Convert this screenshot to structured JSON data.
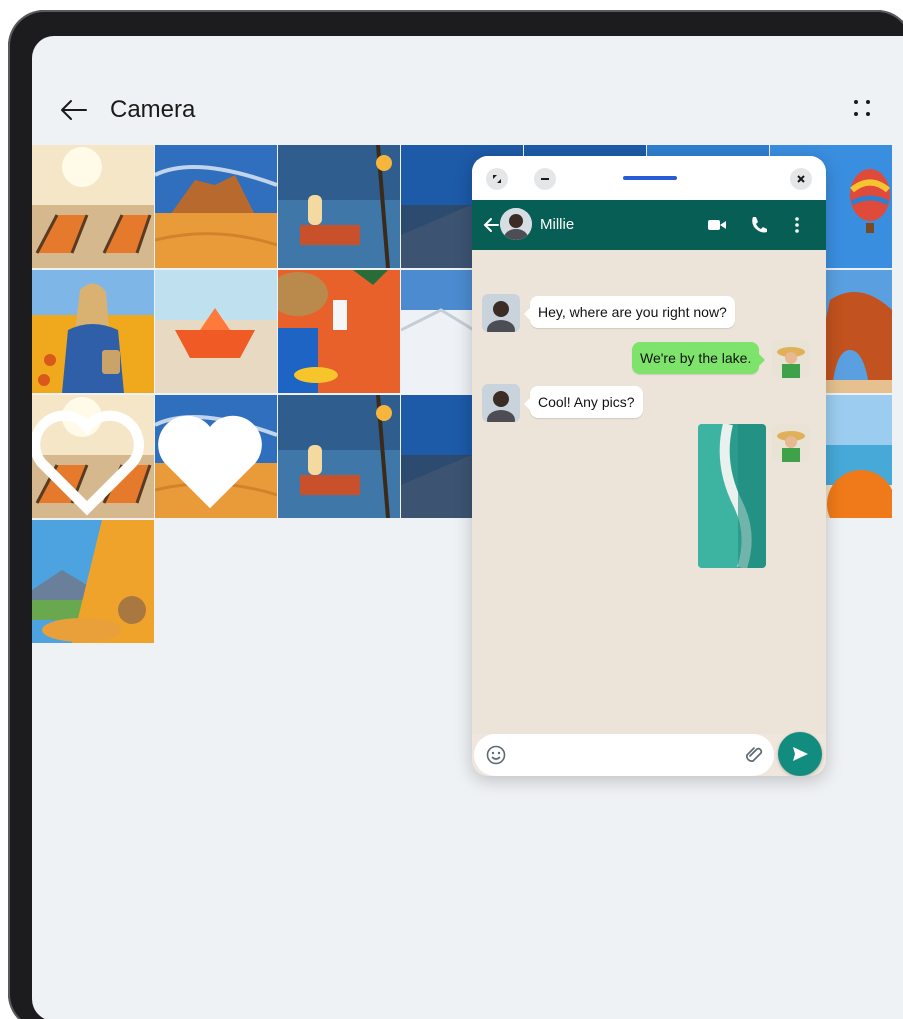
{
  "gallery": {
    "title": "Camera",
    "back_icon": "arrow-left-icon",
    "more_icon": "four-dots-icon"
  },
  "photos": [
    {
      "subject": "beach-chairs"
    },
    {
      "subject": "desert-dunes"
    },
    {
      "subject": "lantern-lake"
    },
    {
      "subject": "coastal-road"
    },
    {
      "subject": "woman-flower-field"
    },
    {
      "subject": "paper-boat"
    },
    {
      "subject": "beach-flatlay"
    },
    {
      "subject": "snow-slope"
    },
    {
      "subject": "beach-chairs",
      "favorite": "outline-heart"
    },
    {
      "subject": "desert-dunes",
      "favorite": "filled-heart"
    },
    {
      "subject": "lantern-lake"
    },
    {
      "subject": "coastal-road"
    },
    {
      "subject": "tent-mountain-view"
    }
  ],
  "window_controls": {
    "fullscreen_icon": "expand-icon",
    "minimize_icon": "minus-icon",
    "close_icon": "close-icon"
  },
  "chat": {
    "contact_name": "Millie",
    "messages": [
      {
        "direction": "in",
        "text": "Hey, where are you right now?"
      },
      {
        "direction": "out",
        "text": "We're by the lake."
      },
      {
        "direction": "in",
        "text": "Cool! Any pics?"
      },
      {
        "direction": "out",
        "type": "image",
        "subject": "aerial-beach"
      }
    ],
    "input_placeholder": "",
    "header_icons": [
      "video-call-icon",
      "phone-icon",
      "more-vertical-icon"
    ]
  },
  "colors": {
    "whatsapp_header": "#075e54",
    "outgoing_bubble": "#7de36b",
    "send_button": "#128c7e",
    "drag_handle": "#2a5bd7"
  }
}
